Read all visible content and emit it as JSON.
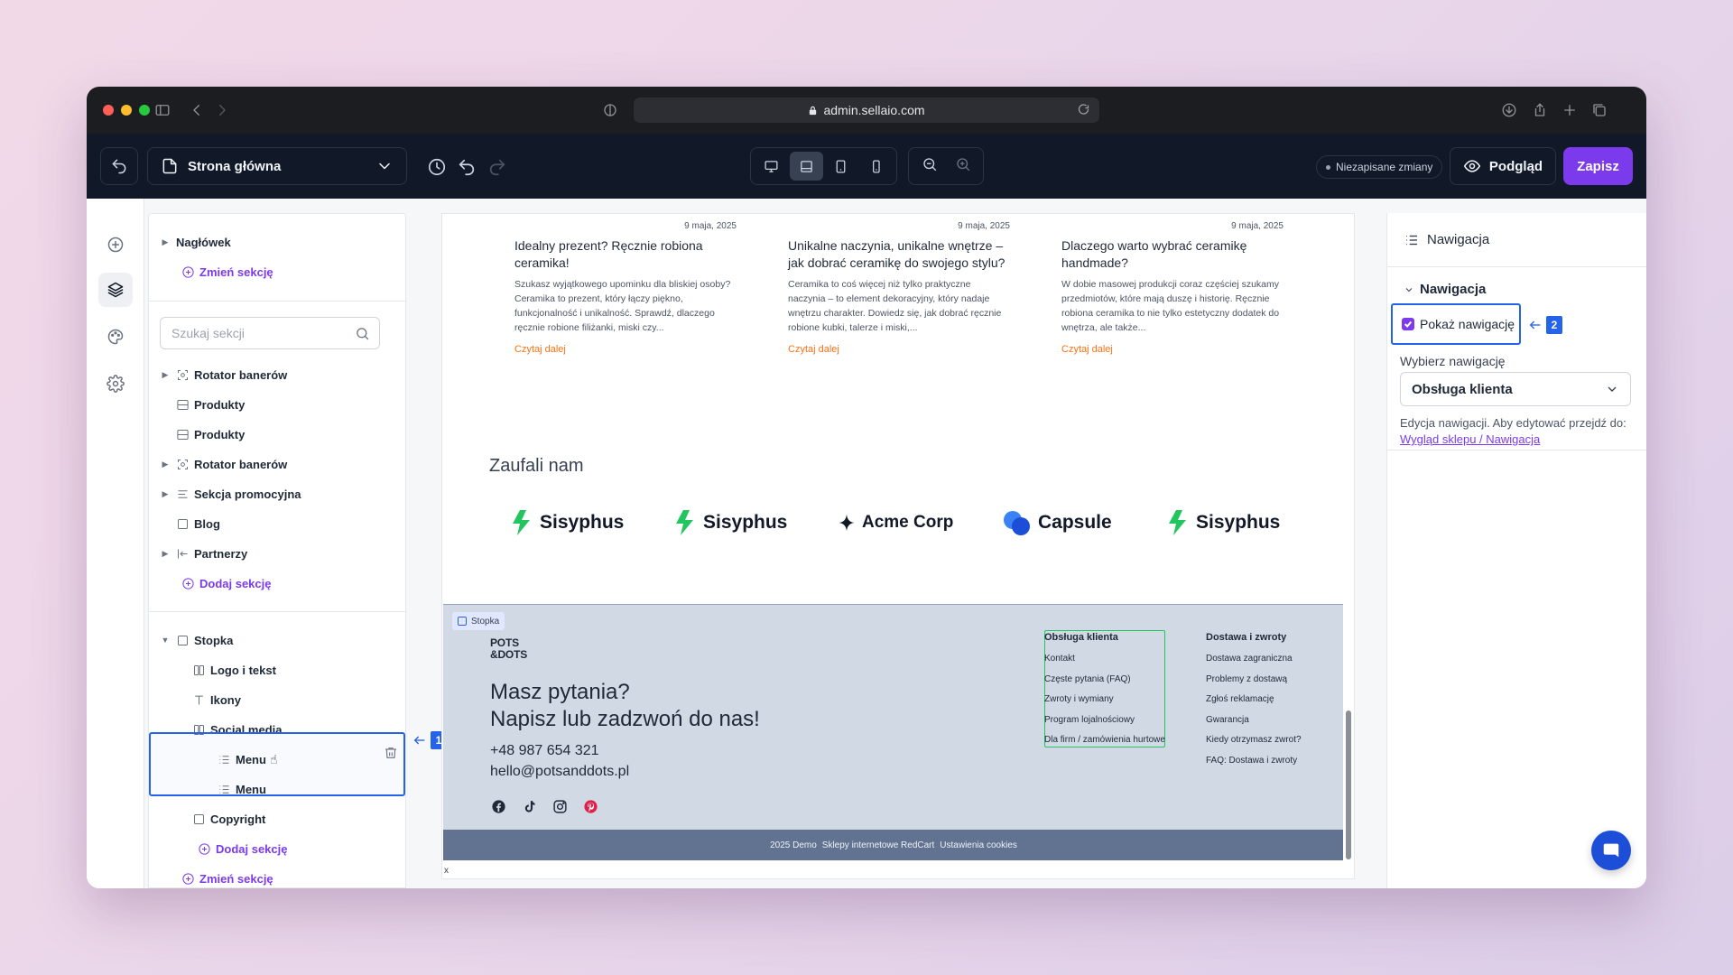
{
  "browser": {
    "url": "admin.sellaio.com"
  },
  "toolbar": {
    "page_name": "Strona główna",
    "unsaved": "Niezapisane zmiany",
    "preview": "Podgląd",
    "save": "Zapisz"
  },
  "tree": {
    "items": [
      {
        "label": "Nagłówek"
      },
      {
        "label": "Zmień sekcję"
      },
      {
        "label": "Rotator banerów"
      },
      {
        "label": "Produkty"
      },
      {
        "label": "Produkty"
      },
      {
        "label": "Rotator banerów"
      },
      {
        "label": "Sekcja promocyjna"
      },
      {
        "label": "Blog"
      },
      {
        "label": "Partnerzy"
      },
      {
        "label": "Dodaj sekcję"
      },
      {
        "label": "Stopka"
      },
      {
        "label": "Logo i tekst"
      },
      {
        "label": "Ikony"
      },
      {
        "label": "Social media"
      },
      {
        "label": "Menu"
      },
      {
        "label": "Menu"
      },
      {
        "label": "Copyright"
      },
      {
        "label": "Dodaj sekcję"
      },
      {
        "label": "Zmień sekcję"
      }
    ],
    "search_placeholder": "Szukaj sekcji"
  },
  "badges": {
    "one": "1",
    "two": "2"
  },
  "canvas": {
    "posts": [
      {
        "date": "9 maja, 2025",
        "title": "Idealny prezent? Ręcznie robiona ceramika!",
        "excerpt": "Szukasz wyjątkowego upominku dla bliskiej osoby? Ceramika to prezent, który łączy piękno, funkcjonalność i unikalność. Sprawdź, dlaczego ręcznie robione filiżanki, miski czy...",
        "more": "Czytaj dalej"
      },
      {
        "date": "9 maja, 2025",
        "title": "Unikalne naczynia, unikalne wnętrze – jak dobrać ceramikę do swojego stylu?",
        "excerpt": "Ceramika to coś więcej niż tylko praktyczne naczynia – to element dekoracyjny, który nadaje wnętrzu charakter. Dowiedz się, jak dobrać ręcznie robione kubki, talerze i miski,...",
        "more": "Czytaj dalej"
      },
      {
        "date": "9 maja, 2025",
        "title": "Dlaczego warto wybrać ceramikę handmade?",
        "excerpt": "W dobie masowej produkcji coraz częściej szukamy przedmiotów, które mają duszę i historię. Ręcznie robiona ceramika to nie tylko estetyczny dodatek do wnętrza, ale także...",
        "more": "Czytaj dalej"
      }
    ],
    "trusted_title": "Zaufali nam",
    "logos": [
      "Sisyphus",
      "Sisyphus",
      "Acme Corp",
      "Capsule",
      "Sisyphus"
    ],
    "footer": {
      "tag": "Stopka",
      "logo_line1": "POTS",
      "logo_line2": "&DOTS",
      "heading_line1": "Masz pytania?",
      "heading_line2": "Napisz lub zadzwoń do nas!",
      "phone": "+48 987 654 321",
      "email": "hello@potsanddots.pl",
      "col1": {
        "title": "Obsługa klienta",
        "items": [
          "Kontakt",
          "Częste pytania (FAQ)",
          "Zwroty i wymiany",
          "Program lojalnościowy",
          "Dla firm / zamówienia hurtowe"
        ]
      },
      "col2": {
        "title": "Dostawa i zwroty",
        "items": [
          "Dostawa zagraniczna",
          "Problemy z dostawą",
          "Zgłoś reklamację",
          "Gwarancja",
          "Kiedy otrzymasz zwrot?",
          "FAQ: Dostawa i zwroty"
        ]
      },
      "copyright": [
        "2025 Demo",
        "Sklepy internetowe RedCart",
        "Ustawienia cookies"
      ]
    },
    "x_mark": "x"
  },
  "panel": {
    "title": "Nawigacja",
    "section": "Nawigacja",
    "checkbox_label": "Pokaż nawigację",
    "checkbox_checked": true,
    "select_label": "Wybierz nawigację",
    "select_value": "Obsługa klienta",
    "help_text": "Edycja nawigacji. Aby edytować przejdź do:",
    "help_link": "Wygląd sklepu / Nawigacja"
  },
  "colors": {
    "accent": "#7c3aed",
    "selection": "#2563eb",
    "toolbar_bg": "#111827",
    "link_orange": "#f97316",
    "footer_bg": "#d1d9e4",
    "copyright_bg": "#627391"
  }
}
